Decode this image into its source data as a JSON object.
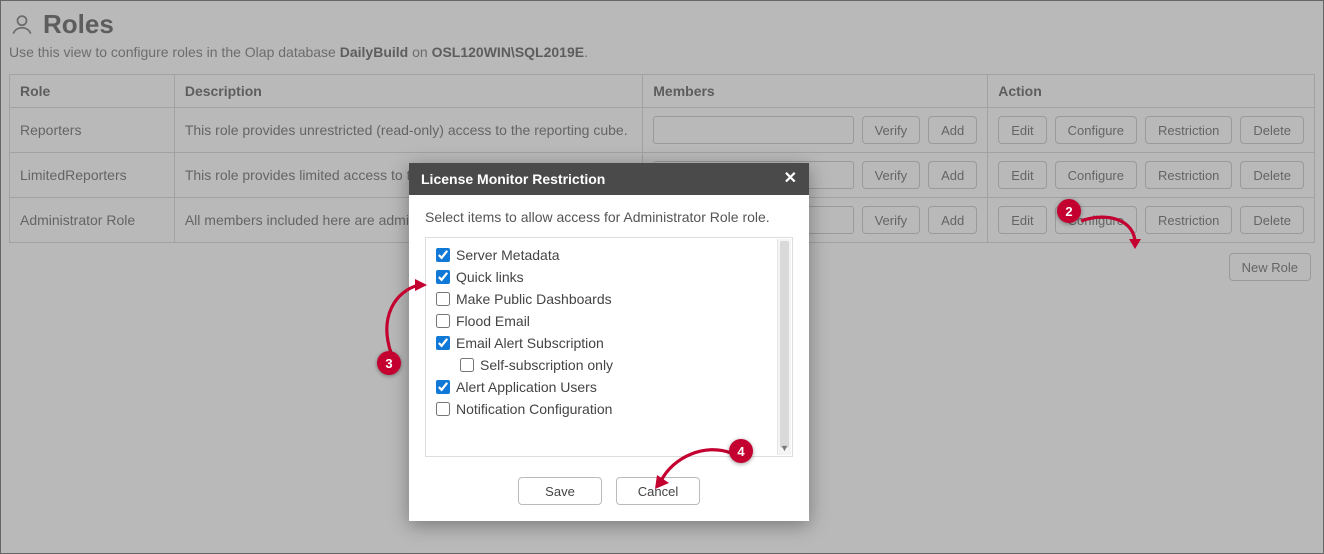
{
  "page": {
    "title": "Roles",
    "subtitle_prefix": "Use this view to configure roles in the Olap database ",
    "db_name": "DailyBuild",
    "subtitle_on": " on ",
    "server_name": "OSL120WIN\\SQL2019E",
    "subtitle_suffix": "."
  },
  "table": {
    "headers": {
      "role": "Role",
      "description": "Description",
      "members": "Members",
      "action": "Action"
    },
    "member_buttons": {
      "verify": "Verify",
      "add": "Add"
    },
    "action_buttons": {
      "edit": "Edit",
      "configure": "Configure",
      "restriction": "Restriction",
      "delete": "Delete"
    },
    "rows": [
      {
        "role": "Reporters",
        "description": "This role provides unrestricted (read-only) access to the reporting cube."
      },
      {
        "role": "LimitedReporters",
        "description": "This role provides limited access to the reporting cube."
      },
      {
        "role": "Administrator Role",
        "description": "All members included here are administrators."
      }
    ],
    "new_role": "New Role"
  },
  "modal": {
    "title": "License Monitor Restriction",
    "close": "✕",
    "instruction": "Select items to allow access for Administrator Role role.",
    "options": [
      {
        "key": "server_metadata",
        "label": "Server Metadata",
        "checked": true
      },
      {
        "key": "quick_links",
        "label": "Quick links",
        "checked": true
      },
      {
        "key": "make_public_dashboards",
        "label": "Make Public Dashboards",
        "checked": false
      },
      {
        "key": "flood_email",
        "label": "Flood Email",
        "checked": false
      },
      {
        "key": "email_alert_subscription",
        "label": "Email Alert Subscription",
        "checked": true
      },
      {
        "key": "self_subscription_only",
        "label": "Self-subscription only",
        "checked": false,
        "nested": true
      },
      {
        "key": "alert_application_users",
        "label": "Alert Application Users",
        "checked": true
      },
      {
        "key": "notification_configuration",
        "label": "Notification Configuration",
        "checked": false
      }
    ],
    "save": "Save",
    "cancel": "Cancel"
  },
  "callouts": {
    "c2": "2",
    "c3": "3",
    "c4": "4"
  }
}
